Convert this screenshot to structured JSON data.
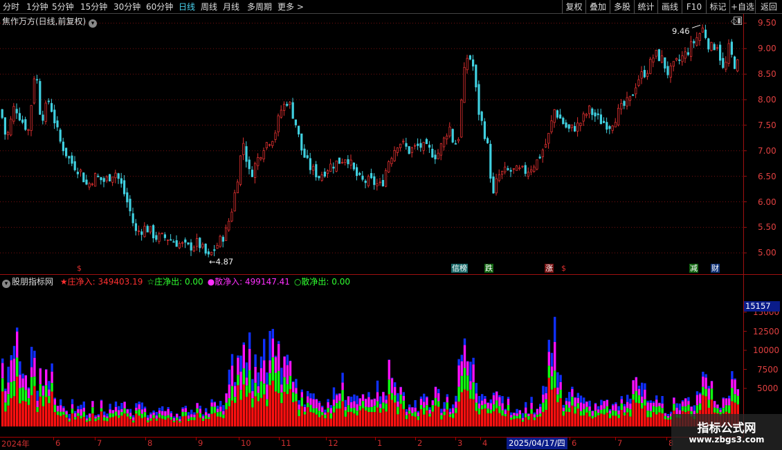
{
  "toolbar": {
    "periods": [
      "分时",
      "1分钟",
      "5分钟",
      "15分钟",
      "30分钟",
      "60分钟",
      "日线",
      "周线",
      "月线",
      "多周期",
      "更多 >"
    ],
    "active_period": "日线",
    "right_buttons": [
      "复权",
      "叠加",
      "多股",
      "统计",
      "画线",
      "F10",
      "标记",
      "+自选",
      "返回"
    ]
  },
  "price_pane": {
    "title": "焦作万方(日线,前复权)",
    "high_annotation": "9.46",
    "low_annotation": "4.87"
  },
  "indicator_pane": {
    "title": "股朋指标网",
    "values": [
      {
        "label": "★庄净入:",
        "value": "349403.19",
        "color": "#ff3030"
      },
      {
        "label": "☆庄净出:",
        "value": "0.00",
        "color": "#30ff30"
      },
      {
        "label": "●散净入:",
        "value": "499147.41",
        "color": "#ff30ff"
      },
      {
        "label": "○散净出:",
        "value": "0.00",
        "color": "#30ff30"
      }
    ],
    "current_value": "15157"
  },
  "event_tags": [
    {
      "text": "$",
      "color": "#e03030",
      "bg": "transparent"
    },
    {
      "text": "信榜",
      "color": "#fff",
      "bg": "#1a6a6a"
    },
    {
      "text": "跌",
      "color": "#fff",
      "bg": "#116611"
    },
    {
      "text": "涨",
      "color": "#fff",
      "bg": "#771111"
    },
    {
      "text": "$",
      "color": "#e03030",
      "bg": "transparent"
    },
    {
      "text": "减",
      "color": "#fff",
      "bg": "#116611"
    },
    {
      "text": "财",
      "color": "#fff",
      "bg": "#113377"
    }
  ],
  "date_axis": {
    "labels": [
      "2024年",
      "6",
      "7",
      "8",
      "9",
      "10",
      "11",
      "12",
      "1",
      "2",
      "3",
      "4",
      "6",
      "7",
      "8"
    ],
    "selected": "2025/04/17/四"
  },
  "watermark": {
    "title": "指标公式网",
    "url": "www.zbgs3.com"
  },
  "chart_data": [
    {
      "type": "candlestick",
      "title": "焦作万方(日线,前复权)",
      "y_ticks": [
        5.0,
        5.5,
        6.0,
        6.5,
        7.0,
        7.5,
        8.0,
        8.5,
        9.0,
        9.5
      ],
      "ylim": [
        4.8,
        9.6
      ],
      "grid": true,
      "colors": {
        "up": "#e03030",
        "down": "#40d0e0"
      },
      "close_path": [
        [
          0,
          7.8
        ],
        [
          8,
          7.2
        ],
        [
          20,
          7.9
        ],
        [
          30,
          7.6
        ],
        [
          40,
          7.4
        ],
        [
          50,
          8.7
        ],
        [
          58,
          7.6
        ],
        [
          70,
          8.0
        ],
        [
          85,
          7.2
        ],
        [
          100,
          6.8
        ],
        [
          115,
          6.6
        ],
        [
          125,
          6.3
        ],
        [
          135,
          6.5
        ],
        [
          150,
          6.4
        ],
        [
          165,
          6.6
        ],
        [
          175,
          6.3
        ],
        [
          185,
          5.9
        ],
        [
          195,
          5.4
        ],
        [
          210,
          5.5
        ],
        [
          225,
          5.3
        ],
        [
          240,
          5.3
        ],
        [
          255,
          5.2
        ],
        [
          270,
          5.1
        ],
        [
          285,
          5.2
        ],
        [
          300,
          4.9
        ],
        [
          315,
          5.2
        ],
        [
          325,
          5.4
        ],
        [
          333,
          5.8
        ],
        [
          340,
          6.3
        ],
        [
          350,
          7.2
        ],
        [
          360,
          6.5
        ],
        [
          370,
          6.8
        ],
        [
          380,
          7.1
        ],
        [
          395,
          7.3
        ],
        [
          405,
          7.8
        ],
        [
          415,
          8.0
        ],
        [
          425,
          7.6
        ],
        [
          435,
          7.0
        ],
        [
          445,
          6.7
        ],
        [
          460,
          6.5
        ],
        [
          475,
          6.7
        ],
        [
          490,
          6.8
        ],
        [
          500,
          6.9
        ],
        [
          510,
          6.6
        ],
        [
          520,
          6.4
        ],
        [
          535,
          6.4
        ],
        [
          550,
          6.3
        ],
        [
          560,
          6.8
        ],
        [
          575,
          7.2
        ],
        [
          590,
          7.0
        ],
        [
          605,
          7.1
        ],
        [
          620,
          7.0
        ],
        [
          630,
          6.9
        ],
        [
          640,
          7.2
        ],
        [
          648,
          7.5
        ],
        [
          655,
          7.1
        ],
        [
          662,
          7.3
        ],
        [
          668,
          8.4
        ],
        [
          675,
          8.9
        ],
        [
          682,
          8.7
        ],
        [
          690,
          7.8
        ],
        [
          700,
          7.3
        ],
        [
          706,
          6.9
        ],
        [
          710,
          6.0
        ],
        [
          718,
          6.5
        ],
        [
          730,
          6.6
        ],
        [
          745,
          6.6
        ],
        [
          760,
          6.6
        ],
        [
          775,
          6.8
        ],
        [
          790,
          7.2
        ],
        [
          800,
          7.8
        ],
        [
          810,
          7.6
        ],
        [
          820,
          7.4
        ],
        [
          835,
          7.5
        ],
        [
          850,
          7.8
        ],
        [
          865,
          7.6
        ],
        [
          880,
          7.5
        ],
        [
          895,
          7.8
        ],
        [
          910,
          8.0
        ],
        [
          920,
          8.4
        ],
        [
          935,
          8.6
        ],
        [
          945,
          8.9
        ],
        [
          955,
          8.8
        ],
        [
          965,
          8.5
        ],
        [
          975,
          8.7
        ],
        [
          990,
          8.9
        ],
        [
          1005,
          9.2
        ],
        [
          1015,
          9.4
        ],
        [
          1025,
          9.0
        ],
        [
          1035,
          9.1
        ],
        [
          1045,
          8.5
        ],
        [
          1052,
          9.0
        ],
        [
          1060,
          8.7
        ]
      ],
      "high": 9.46,
      "low": 4.87
    },
    {
      "type": "bar",
      "title": "股朋指标网",
      "stacked": true,
      "y_ticks": [
        5000,
        7500,
        10000,
        12500,
        15000
      ],
      "ylim": [
        0,
        18000
      ],
      "series": [
        {
          "name": "庄净入",
          "color": "#ff1010"
        },
        {
          "name": "庄净出",
          "color": "#10ff10"
        },
        {
          "name": "散净入",
          "color": "#ff10ff"
        },
        {
          "name": "散净出",
          "color": "#1030ff"
        }
      ],
      "total_profile": [
        [
          0,
          10000
        ],
        [
          10,
          9000
        ],
        [
          20,
          15000
        ],
        [
          30,
          7000
        ],
        [
          45,
          12000
        ],
        [
          60,
          6000
        ],
        [
          70,
          11000
        ],
        [
          85,
          4500
        ],
        [
          100,
          3500
        ],
        [
          130,
          3000
        ],
        [
          160,
          3800
        ],
        [
          190,
          3200
        ],
        [
          220,
          3000
        ],
        [
          260,
          2500
        ],
        [
          300,
          3200
        ],
        [
          320,
          4500
        ],
        [
          335,
          12500
        ],
        [
          345,
          11000
        ],
        [
          355,
          12000
        ],
        [
          375,
          11000
        ],
        [
          395,
          12700
        ],
        [
          410,
          10500
        ],
        [
          425,
          7000
        ],
        [
          440,
          5000
        ],
        [
          460,
          4500
        ],
        [
          480,
          5000
        ],
        [
          495,
          7500
        ],
        [
          510,
          4000
        ],
        [
          530,
          4500
        ],
        [
          550,
          7500
        ],
        [
          565,
          8500
        ],
        [
          580,
          5500
        ],
        [
          600,
          4000
        ],
        [
          620,
          4500
        ],
        [
          640,
          5000
        ],
        [
          655,
          3500
        ],
        [
          668,
          17500
        ],
        [
          678,
          14500
        ],
        [
          690,
          9000
        ],
        [
          700,
          5000
        ],
        [
          720,
          4500
        ],
        [
          740,
          4000
        ],
        [
          760,
          3500
        ],
        [
          780,
          4500
        ],
        [
          790,
          10000
        ],
        [
          798,
          15500
        ],
        [
          808,
          7000
        ],
        [
          820,
          5000
        ],
        [
          840,
          5000
        ],
        [
          860,
          4000
        ],
        [
          880,
          3500
        ],
        [
          900,
          4000
        ],
        [
          915,
          6500
        ],
        [
          930,
          8000
        ],
        [
          945,
          5000
        ],
        [
          960,
          3500
        ],
        [
          980,
          4000
        ],
        [
          1000,
          4500
        ],
        [
          1018,
          10000
        ],
        [
          1030,
          6000
        ],
        [
          1045,
          5000
        ],
        [
          1062,
          8000
        ]
      ]
    }
  ]
}
